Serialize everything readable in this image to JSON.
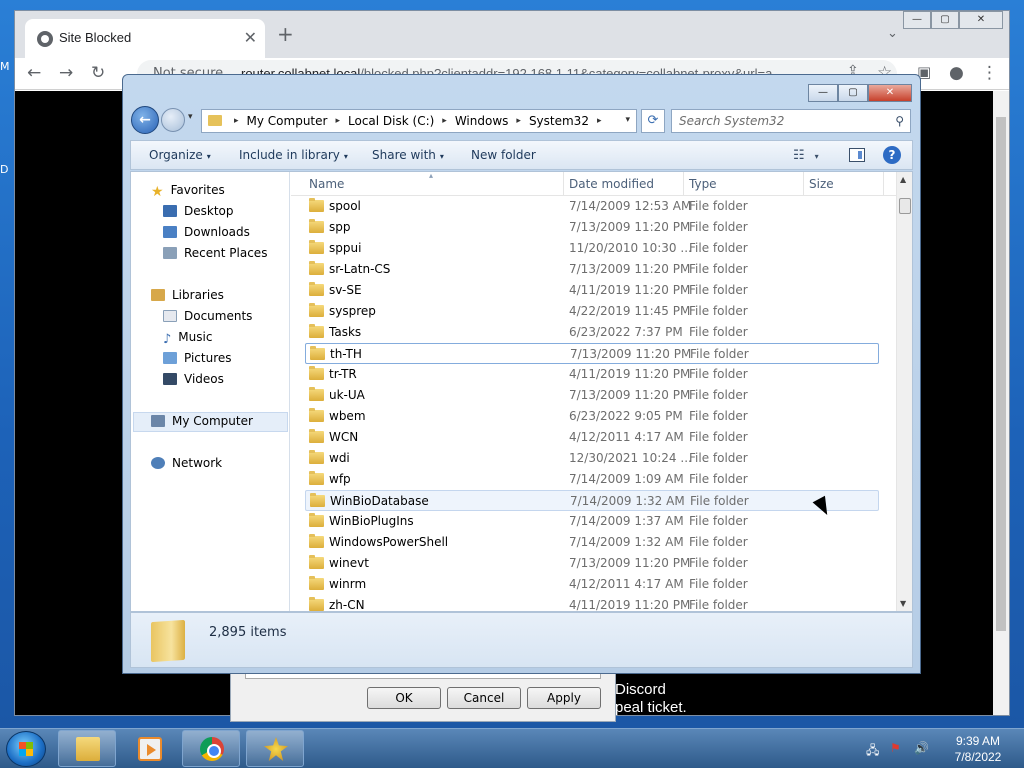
{
  "desktop": {
    "edge_text_1": "M",
    "edge_text_2": "D"
  },
  "browser": {
    "tab_title": "Site Blocked",
    "tab_close": "✕",
    "new_tab": "+",
    "tab_search": "⌄",
    "window_controls": {
      "minimize": "—",
      "maximize": "▢",
      "close": "✕"
    },
    "toolbar": {
      "back": "←",
      "forward": "→",
      "reload": "↻",
      "share": "⇪",
      "star": "☆",
      "sidepanel": "▣",
      "profile": "●",
      "menu": "⋮"
    },
    "omnibox": {
      "security_label": "Not secure",
      "host": "router.collabnet.local",
      "path": "/blocked.php?clientaddr=192.168.1.11&category=collabnet-proxy&url=a"
    },
    "page_text": {
      "line1": "Discord",
      "line2": "peal ticket."
    }
  },
  "properties_dialog": {
    "ok": "OK",
    "cancel": "Cancel",
    "apply": "Apply"
  },
  "explorer": {
    "window_controls": {
      "minimize": "—",
      "maximize": "▢",
      "close": "✕"
    },
    "nav": {
      "back": "←",
      "dropdown": "▾"
    },
    "breadcrumbs": [
      "My Computer",
      "Local Disk (C:)",
      "Windows",
      "System32"
    ],
    "breadcrumb_sep": "▸",
    "refresh": "⟳",
    "search_placeholder": "Search System32",
    "search_icon": "⚲",
    "commands": {
      "organize": "Organize",
      "include": "Include in library",
      "share": "Share with",
      "new_folder": "New folder",
      "caret": "▾",
      "views": "☷",
      "help": "?"
    },
    "navpane": {
      "favorites": "Favorites",
      "desktop": "Desktop",
      "downloads": "Downloads",
      "recent": "Recent Places",
      "libraries": "Libraries",
      "documents": "Documents",
      "music": "Music",
      "pictures": "Pictures",
      "videos": "Videos",
      "computer": "My Computer",
      "network": "Network"
    },
    "columns": {
      "name": "Name",
      "date": "Date modified",
      "type": "Type",
      "size": "Size",
      "sort_arrow": "▴"
    },
    "files": [
      {
        "name": "spool",
        "date": "7/14/2009 12:53 AM",
        "type": "File folder"
      },
      {
        "name": "spp",
        "date": "7/13/2009 11:20 PM",
        "type": "File folder"
      },
      {
        "name": "sppui",
        "date": "11/20/2010 10:30 ...",
        "type": "File folder"
      },
      {
        "name": "sr-Latn-CS",
        "date": "7/13/2009 11:20 PM",
        "type": "File folder"
      },
      {
        "name": "sv-SE",
        "date": "4/11/2019 11:20 PM",
        "type": "File folder"
      },
      {
        "name": "sysprep",
        "date": "4/22/2019 11:45 PM",
        "type": "File folder"
      },
      {
        "name": "Tasks",
        "date": "6/23/2022 7:37 PM",
        "type": "File folder"
      },
      {
        "name": "th-TH",
        "date": "7/13/2009 11:20 PM",
        "type": "File folder"
      },
      {
        "name": "tr-TR",
        "date": "4/11/2019 11:20 PM",
        "type": "File folder"
      },
      {
        "name": "uk-UA",
        "date": "7/13/2009 11:20 PM",
        "type": "File folder"
      },
      {
        "name": "wbem",
        "date": "6/23/2022 9:05 PM",
        "type": "File folder"
      },
      {
        "name": "WCN",
        "date": "4/12/2011 4:17 AM",
        "type": "File folder"
      },
      {
        "name": "wdi",
        "date": "12/30/2021 10:24 ...",
        "type": "File folder"
      },
      {
        "name": "wfp",
        "date": "7/14/2009 1:09 AM",
        "type": "File folder"
      },
      {
        "name": "WinBioDatabase",
        "date": "7/14/2009 1:32 AM",
        "type": "File folder"
      },
      {
        "name": "WinBioPlugIns",
        "date": "7/14/2009 1:37 AM",
        "type": "File folder"
      },
      {
        "name": "WindowsPowerShell",
        "date": "7/14/2009 1:32 AM",
        "type": "File folder"
      },
      {
        "name": "winevt",
        "date": "7/13/2009 11:20 PM",
        "type": "File folder"
      },
      {
        "name": "winrm",
        "date": "4/12/2011 4:17 AM",
        "type": "File folder"
      },
      {
        "name": "zh-CN",
        "date": "4/11/2019 11:20 PM",
        "type": "File folder"
      }
    ],
    "selected_item": "th-TH",
    "hovered_item": "WinBioDatabase",
    "scroll": {
      "up": "▲",
      "down": "▼"
    },
    "item_count": "2,895 items"
  },
  "taskbar": {
    "clock_time": "9:39 AM",
    "clock_date": "7/8/2022",
    "tray": {
      "network": "🖧",
      "flag": "⚑",
      "volume": "🔊"
    }
  }
}
